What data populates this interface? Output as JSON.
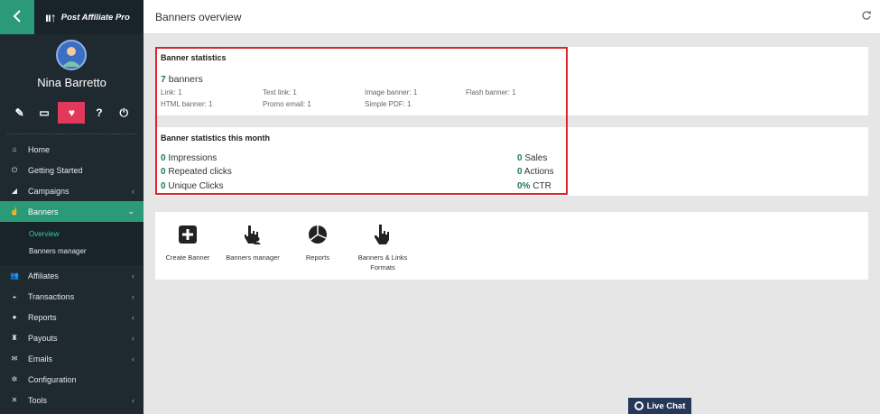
{
  "app": {
    "logo_mark": "ıı↑",
    "logo_name": "Post Affiliate Pro"
  },
  "user": {
    "name": "Nina Barretto"
  },
  "toolbar": [
    {
      "icon": "edit-icon",
      "glyph": "✎"
    },
    {
      "icon": "monitor-icon",
      "glyph": "▭"
    },
    {
      "icon": "heartbeat-icon",
      "glyph": "♥"
    },
    {
      "icon": "help-icon",
      "glyph": "?"
    },
    {
      "icon": "power-icon",
      "glyph": "⏻"
    }
  ],
  "menu": {
    "home": "Home",
    "getting_started": "Getting Started",
    "campaigns": "Campaigns",
    "banners": "Banners",
    "banners_sub": {
      "overview": "Overview",
      "manager": "Banners manager"
    },
    "affiliates": "Affiliates",
    "transactions": "Transactions",
    "reports": "Reports",
    "payouts": "Payouts",
    "emails": "Emails",
    "configuration": "Configuration",
    "tools": "Tools"
  },
  "header": {
    "title": "Banners overview"
  },
  "banner_stats": {
    "heading": "Banner statistics",
    "count": "7",
    "count_label": "banners",
    "link": "Link: 1",
    "text_link": "Text link: 1",
    "image_banner": "Image banner: 1",
    "flash_banner": "Flash banner: 1",
    "html_banner": "HTML banner: 1",
    "promo_email": "Promo email: 1",
    "simple_pdf": "Simple PDF: 1"
  },
  "month_stats": {
    "heading": "Banner statistics this month",
    "impressions_val": "0",
    "impressions_label": "Impressions",
    "repeated_val": "0",
    "repeated_label": "Repeated clicks",
    "unique_val": "0",
    "unique_label": "Unique Clicks",
    "sales_val": "0",
    "sales_label": "Sales",
    "actions_val": "0",
    "actions_label": "Actions",
    "ctr_val": "0%",
    "ctr_label": "CTR"
  },
  "quick": {
    "create_banner": "Create Banner",
    "banners_manager": "Banners manager",
    "reports": "Reports",
    "formats": "Banners & Links\nFormats"
  },
  "livechat": {
    "label": "Live Chat"
  },
  "colors": {
    "accent": "#2b9a78",
    "sidebar": "#1f2a30",
    "highlight": "#d9252b",
    "number": "#1f7a5e"
  }
}
